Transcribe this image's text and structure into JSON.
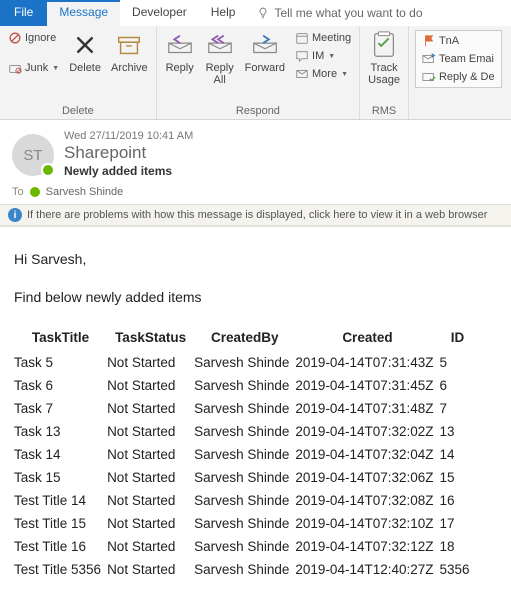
{
  "menu": {
    "file": "File",
    "message": "Message",
    "developer": "Developer",
    "help": "Help",
    "tell_me": "Tell me what you want to do"
  },
  "ribbon": {
    "delete": {
      "ignore": "Ignore",
      "junk": "Junk",
      "delete": "Delete",
      "archive": "Archive",
      "group": "Delete"
    },
    "respond": {
      "reply": "Reply",
      "reply_all": "Reply\nAll",
      "forward": "Forward",
      "meeting": "Meeting",
      "im": "IM",
      "more": "More",
      "group": "Respond"
    },
    "rms": {
      "track": "Track\nUsage",
      "group": "RMS"
    },
    "quick": {
      "tna": "TnA",
      "team": "Team Emai",
      "replyd": "Reply & De"
    }
  },
  "header": {
    "initials": "ST",
    "date": "Wed 27/11/2019 10:41 AM",
    "from": "Sharepoint",
    "subject": "Newly added items",
    "to_label": "To",
    "to_name": "Sarvesh Shinde",
    "info_bar": "If there are problems with how this message is displayed, click here to view it in a web browser"
  },
  "body": {
    "greeting": "Hi Sarvesh,",
    "intro": "Find below newly added items",
    "columns": [
      "TaskTitle",
      "TaskStatus",
      "CreatedBy",
      "Created",
      "ID"
    ],
    "rows": [
      [
        "Task 5",
        "Not Started",
        "Sarvesh Shinde",
        "2019-04-14T07:31:43Z",
        "5"
      ],
      [
        "Task 6",
        "Not Started",
        "Sarvesh Shinde",
        "2019-04-14T07:31:45Z",
        "6"
      ],
      [
        "Task 7",
        "Not Started",
        "Sarvesh Shinde",
        "2019-04-14T07:31:48Z",
        "7"
      ],
      [
        "Task 13",
        "Not Started",
        "Sarvesh Shinde",
        "2019-04-14T07:32:02Z",
        "13"
      ],
      [
        "Task 14",
        "Not Started",
        "Sarvesh Shinde",
        "2019-04-14T07:32:04Z",
        "14"
      ],
      [
        "Task 15",
        "Not Started",
        "Sarvesh Shinde",
        "2019-04-14T07:32:06Z",
        "15"
      ],
      [
        "Test Title 14",
        "Not Started",
        "Sarvesh Shinde",
        "2019-04-14T07:32:08Z",
        "16"
      ],
      [
        "Test Title 15",
        "Not Started",
        "Sarvesh Shinde",
        "2019-04-14T07:32:10Z",
        "17"
      ],
      [
        "Test Title 16",
        "Not Started",
        "Sarvesh Shinde",
        "2019-04-14T07:32:12Z",
        "18"
      ],
      [
        "Test Title 5356",
        "Not Started",
        "Sarvesh Shinde",
        "2019-04-14T12:40:27Z",
        "5356"
      ]
    ]
  }
}
